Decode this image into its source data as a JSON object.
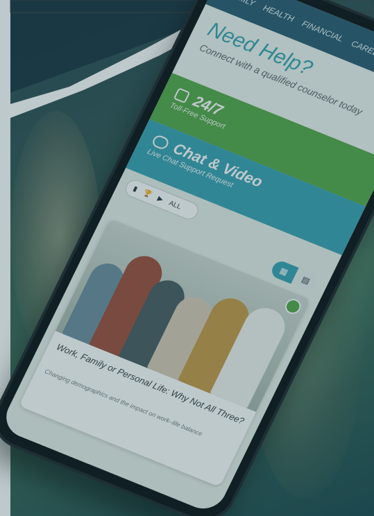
{
  "nav": {
    "items": [
      "FAMILY",
      "HEALTH",
      "FINANCIAL",
      "CAREER"
    ]
  },
  "hero": {
    "title": "Need Help?",
    "subtitle": "Connect with a qualified counselor today"
  },
  "support": {
    "title": "24/7",
    "subtitle": "Toll-Free Support"
  },
  "chat": {
    "title": "Chat & Video",
    "subtitle": "Live Chat Support Request"
  },
  "filter": {
    "all_label": "ALL"
  },
  "card": {
    "title": "Work, Family or Personal Life: Why Not All Three?",
    "subtitle": "Changing demographics and the impact on work–life balance"
  },
  "colors": {
    "nav": "#2d5d73",
    "accent_teal": "#3ca3b4",
    "accent_green": "#56a84a"
  }
}
